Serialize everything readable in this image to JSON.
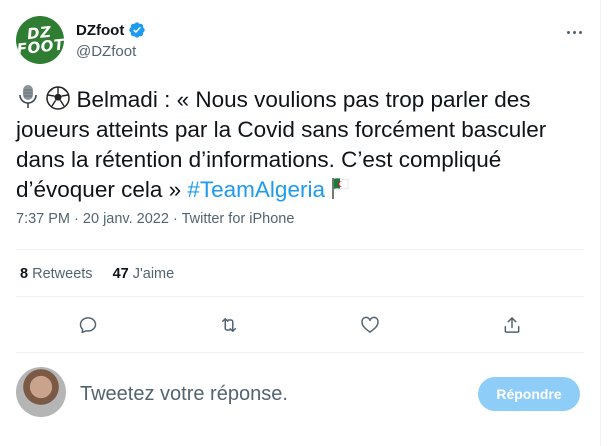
{
  "tweet": {
    "display_name": "DZfoot",
    "handle": "@DZfoot",
    "avatar_logo_text": "DZ FOOT",
    "emojis": [
      "microphone-icon",
      "soccer-ball-icon",
      "algeria-flag-icon"
    ],
    "text": "Belmadi : « Nous voulions pas trop parler des joueurs atteints par la Covid sans forcément basculer dans la rétention d’informations. C’est compliqué d’évoquer cela »",
    "hashtag": "#TeamAlgeria",
    "time": "7:37 PM",
    "separator": "·",
    "date": "20 janv. 2022",
    "source": "Twitter for iPhone"
  },
  "stats": {
    "retweets_count": "8",
    "retweets_label": "Retweets",
    "likes_count": "47",
    "likes_label": "J'aime"
  },
  "actions": [
    "reply-icon",
    "retweet-icon",
    "like-icon",
    "share-icon"
  ],
  "reply": {
    "placeholder": "Tweetez votre réponse.",
    "button_label": "Répondre"
  },
  "colors": {
    "accent": "#1d9bf0",
    "button_disabled": "#8ecdf8",
    "secondary_text": "#536471",
    "divider": "#eff3f4"
  }
}
